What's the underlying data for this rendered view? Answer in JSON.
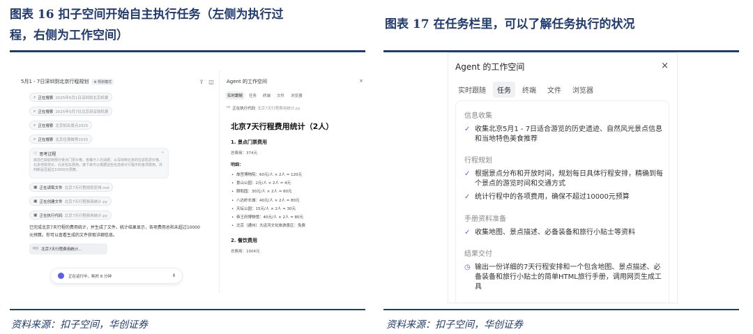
{
  "fig16": {
    "title_line1": "图表 16   扣子空间开始自主执行任务（左侧为执行过",
    "title_line2": "程，右侧为工作空间）",
    "source": "资料来源：扣子空间，华创证券"
  },
  "fig17": {
    "title": "图表 17   在任务栏里，可以了解任务执行的状况",
    "source": "资料来源：扣子空间，华创证券"
  },
  "left": {
    "chat": {
      "title": "5月1 - 7日深圳到北京行程规划",
      "mode_badge": "⊕ 规划模式",
      "share_icon": "⇪",
      "panel_icon": "◫",
      "steps": [
        {
          "icon": "⌕",
          "action": "正在搜索",
          "query": "2025年5月1日深圳到北京机票"
        },
        {
          "icon": "⌕",
          "action": "正在搜索",
          "query": "2025年5月7日北京到深圳机票"
        },
        {
          "icon": "⌕",
          "action": "正在搜索",
          "query": "北京知名景点2025"
        },
        {
          "icon": "⌕",
          "action": "正在搜索",
          "query": "北京住宿推荐2025"
        }
      ],
      "thinking": {
        "icon": "♡",
        "title": "思考过程",
        "chevron": "⌃",
        "body": "目前已获取到部分景点门票价格、各餐厅人均消费。从深圳到北京的往返机票价格、北京地铁票价、北京包车费用，接下来可以根据这些信息统计行程中的各项费用，并判断是否超过10000元预算。"
      },
      "files": [
        {
          "icon": "▣",
          "action": "正在读取文件",
          "name": "北京7天行程规划安排.md"
        },
        {
          "icon": "▣",
          "action": "正在创建文件",
          "name": "北京7天行程费用统计.py"
        },
        {
          "icon": "▣",
          "action": "正在执行代码",
          "name": "北京7天行程费用统计.py"
        }
      ],
      "summary": "已完成北京7天行程的费用统计，并生成了文件。统计结果显示，各项费用总和未超过10000元预算。你可以查看生成的文件获取详细信息。",
      "file_card": {
        "icon": "MD",
        "name": "北京7天行程费用统计..."
      },
      "status": {
        "text": "正在运行中，耗时 8 分钟",
        "pause": "Ⅱ"
      }
    },
    "workspace": {
      "title": "Agent 的工作空间",
      "close": "×",
      "tabs": [
        "实时跟随",
        "任务",
        "终端",
        "文件",
        "浏览器"
      ],
      "exec_icon": "▭",
      "exec_label": "正在执行代码",
      "exec_file": "北京7天行程费用统计.py",
      "doc_title": "北京7天行程费用统计（2人）",
      "section1": "1. 景点门票费用",
      "total1": "总费用：374元",
      "detail_label": "明细：",
      "items": [
        "故宫博物院：60元/人 × 2人 = 120元",
        "景山公园：2元/人 × 2人 = 4元",
        "颐和园：30元/人 × 2人 = 60元",
        "八达岭长城：40元/人 × 2人 = 80元",
        "天坛公园：15元/人 × 2人 = 30元",
        "恭王府博物馆：40元/人 × 2人 = 80元",
        "北京（通州）大运河文化旅游景区：免费"
      ],
      "section2": "2. 餐饮费用",
      "total2": "总费用：1004元"
    }
  },
  "right": {
    "title": "Agent 的工作空间",
    "close": "×",
    "tabs": [
      "实时跟随",
      "任务",
      "终端",
      "文件",
      "浏览器"
    ],
    "groups": [
      {
        "title": "信息收集",
        "tasks": [
          {
            "mark": "✓",
            "text": "收集北京5月1 - 7日适合游览的历史遗迹、自然风光景点信息和当地特色美食推荐"
          }
        ]
      },
      {
        "title": "行程规划",
        "tasks": [
          {
            "mark": "✓",
            "text": "根据景点分布和开放时间，规划每日具体行程安排，精确到每个景点的游览时间和交通方式"
          },
          {
            "mark": "✓",
            "text": "统计行程中的各项费用，确保不超过10000元预算"
          }
        ]
      },
      {
        "title": "手册资料准备",
        "tasks": [
          {
            "mark": "✓",
            "text": "收集地图、景点描述、必备装备和旅行小贴士等资料"
          }
        ]
      },
      {
        "title": "结果交付",
        "tasks": [
          {
            "mark": "◷",
            "text": "输出一份详细的7天行程安排和一个包含地图、景点描述、必备装备和旅行小贴士的简单HTML旅行手册，调用网页生成工具"
          }
        ]
      }
    ]
  },
  "colors": {
    "accent": "#1f3b72",
    "agent": "#5b5cf0"
  }
}
